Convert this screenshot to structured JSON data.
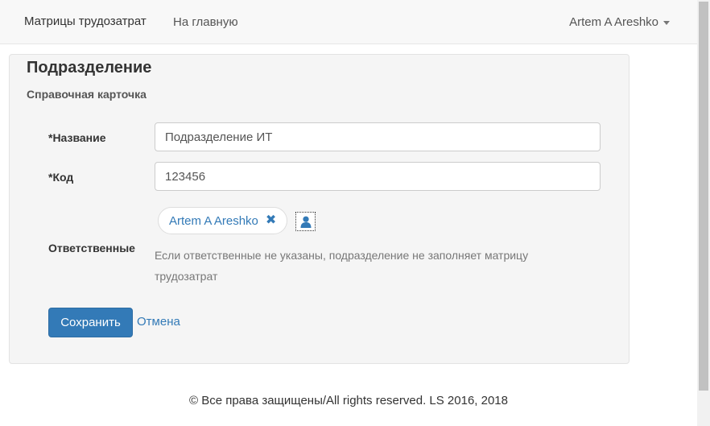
{
  "navbar": {
    "brand": "Матрицы трудозатрат",
    "home_link": "На главную",
    "user_name": "Artem A Areshko"
  },
  "panel": {
    "title": "Подразделение",
    "subtitle": "Справочная карточка"
  },
  "form": {
    "name_label": "*Название",
    "name_value": "Подразделение ИТ",
    "code_label": "*Код",
    "code_value": "123456",
    "responsible_label": "Ответственные",
    "responsible_tag": "Artem A Areshko",
    "responsible_hint": "Если ответственные не указаны, подразделение не заполняет матрицу трудозатрат"
  },
  "actions": {
    "save_label": "Сохранить",
    "cancel_label": "Отмена"
  },
  "footer": {
    "text": "© Все права защищены/All rights reserved. LS 2016, 2018"
  },
  "icons": {
    "tag_remove": "close-icon",
    "pick_user": "user-icon",
    "dropdown": "caret-down-icon"
  },
  "colors": {
    "primary": "#337ab7",
    "navbar_bg": "#f8f8f8",
    "panel_bg": "#f5f5f5"
  }
}
